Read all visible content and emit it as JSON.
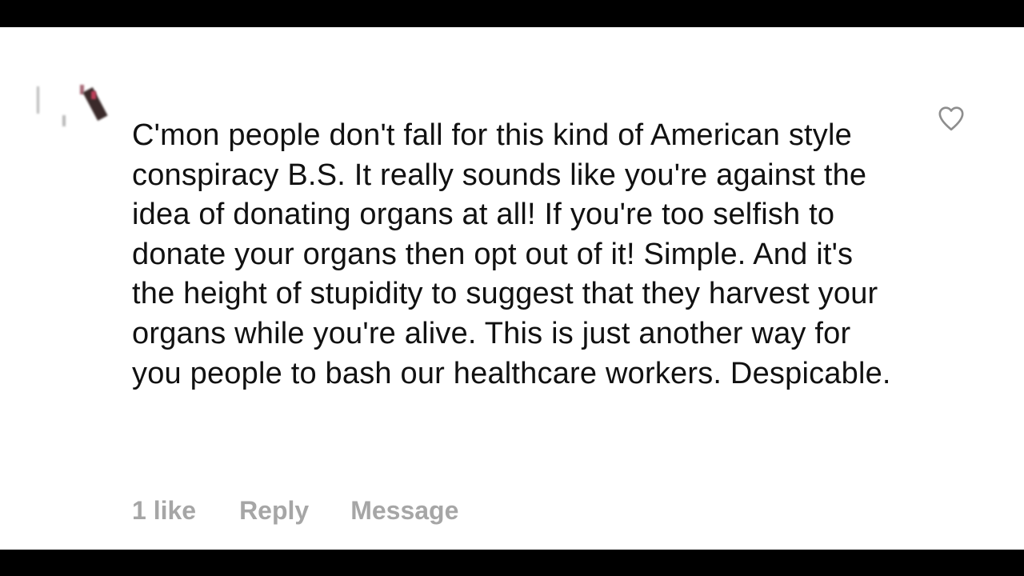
{
  "comment": {
    "text": "C'mon people don't fall for this kind of American style conspiracy B.S. It really sounds like you're against the idea of donating organs at all! If you're too selfish to donate your organs then opt out of it! Simple. And it's the height of stupidity to suggest that they harvest your organs while you're alive. This is just another way for you people to bash our healthcare workers. Despicable.",
    "likes_label": "1 like",
    "reply_label": "Reply",
    "message_label": "Message",
    "like_icon": "heart-outline-icon"
  },
  "colors": {
    "background": "#ffffff",
    "letterbox": "#000000",
    "text": "#111111",
    "secondary_text": "#a6a6a6",
    "icon": "#8e8e8e"
  }
}
